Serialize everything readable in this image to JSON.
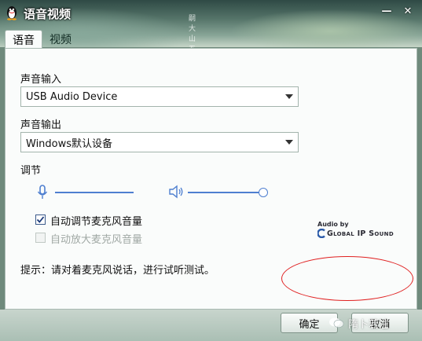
{
  "window": {
    "title": "语音视频",
    "calligraphy": "嗣大山五鼎",
    "minimize_glyph": "—",
    "close_glyph": "✕"
  },
  "tabs": [
    {
      "label": "语音",
      "active": true
    },
    {
      "label": "视频",
      "active": false
    }
  ],
  "voice": {
    "input_label": "声音输入",
    "input_value": "USB Audio Device",
    "output_label": "声音输出",
    "output_value": "Windows默认设备",
    "adjust_label": "调节",
    "mic_level": 1.0,
    "speaker_level": 1.0,
    "auto_mic_label": "自动调节麦克风音量",
    "auto_mic_checked": true,
    "amplify_mic_label": "自动放大麦克风音量",
    "amplify_mic_checked": false,
    "amplify_mic_enabled": false,
    "hint": "提示：请对着麦克风说话，进行试听测试。"
  },
  "branding": {
    "audio_by": "Audio by",
    "gips": "Global IP Sound"
  },
  "buttons": {
    "ok": "确定",
    "cancel": "取消"
  },
  "watermark": "隋卜若注",
  "colors": {
    "accent": "#4e7fd0",
    "annotation": "#e02020"
  }
}
